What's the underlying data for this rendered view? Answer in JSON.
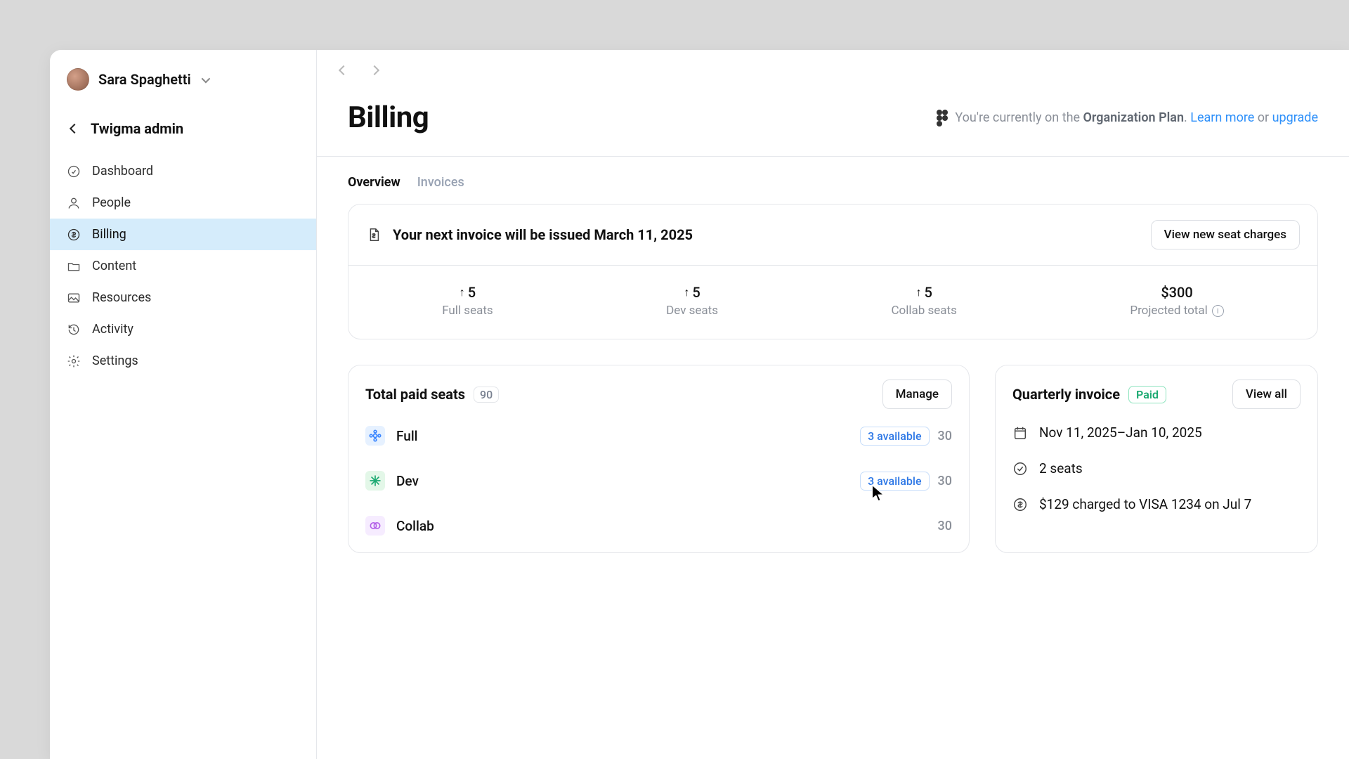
{
  "user": {
    "name": "Sara Spaghetti"
  },
  "admin_title": "Twigma admin",
  "nav": {
    "dashboard": "Dashboard",
    "people": "People",
    "billing": "Billing",
    "content": "Content",
    "resources": "Resources",
    "activity": "Activity",
    "settings": "Settings"
  },
  "page": {
    "title": "Billing",
    "banner_prefix": "You're currently on the ",
    "banner_plan": "Organization Plan",
    "banner_suffix": ". ",
    "learn_more": "Learn more",
    "or": " or ",
    "upgrade": "upgrade"
  },
  "tabs": {
    "overview": "Overview",
    "invoices": "Invoices"
  },
  "next_invoice": {
    "title": "Your next invoice will be issued March 11, 2025",
    "button": "View new seat charges",
    "stats": [
      {
        "value": "5",
        "label": "Full seats"
      },
      {
        "value": "5",
        "label": "Dev seats"
      },
      {
        "value": "5",
        "label": "Collab seats"
      }
    ],
    "total_value": "$300",
    "total_label": "Projected total"
  },
  "seats_card": {
    "title": "Total paid seats",
    "count": "90",
    "manage": "Manage",
    "rows": [
      {
        "name": "Full",
        "available": "3 available",
        "count": "30"
      },
      {
        "name": "Dev",
        "available": "3 available",
        "count": "30"
      },
      {
        "name": "Collab",
        "available": "",
        "count": "30"
      }
    ]
  },
  "quarterly": {
    "title": "Quarterly invoice",
    "status": "Paid",
    "view_all": "View all",
    "date_range": "Nov 11, 2025–Jan 10, 2025",
    "seats": "2 seats",
    "charge": "$129 charged to VISA 1234 on Jul 7"
  }
}
